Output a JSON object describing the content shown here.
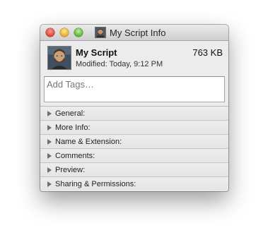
{
  "window": {
    "title": "My Script Info",
    "avatar_icon": "user-portrait-icon"
  },
  "file": {
    "name": "My Script",
    "modified": "Modified: Today, 9:12 PM",
    "size": "763 KB"
  },
  "tags": {
    "placeholder": "Add Tags…",
    "value": ""
  },
  "sections": [
    {
      "label": "General:"
    },
    {
      "label": "More Info:"
    },
    {
      "label": "Name & Extension:"
    },
    {
      "label": "Comments:"
    },
    {
      "label": "Preview:"
    },
    {
      "label": "Sharing & Permissions:"
    }
  ],
  "colors": {
    "close": "#e2463a",
    "minimize": "#e9b12a",
    "zoom": "#62b641"
  }
}
